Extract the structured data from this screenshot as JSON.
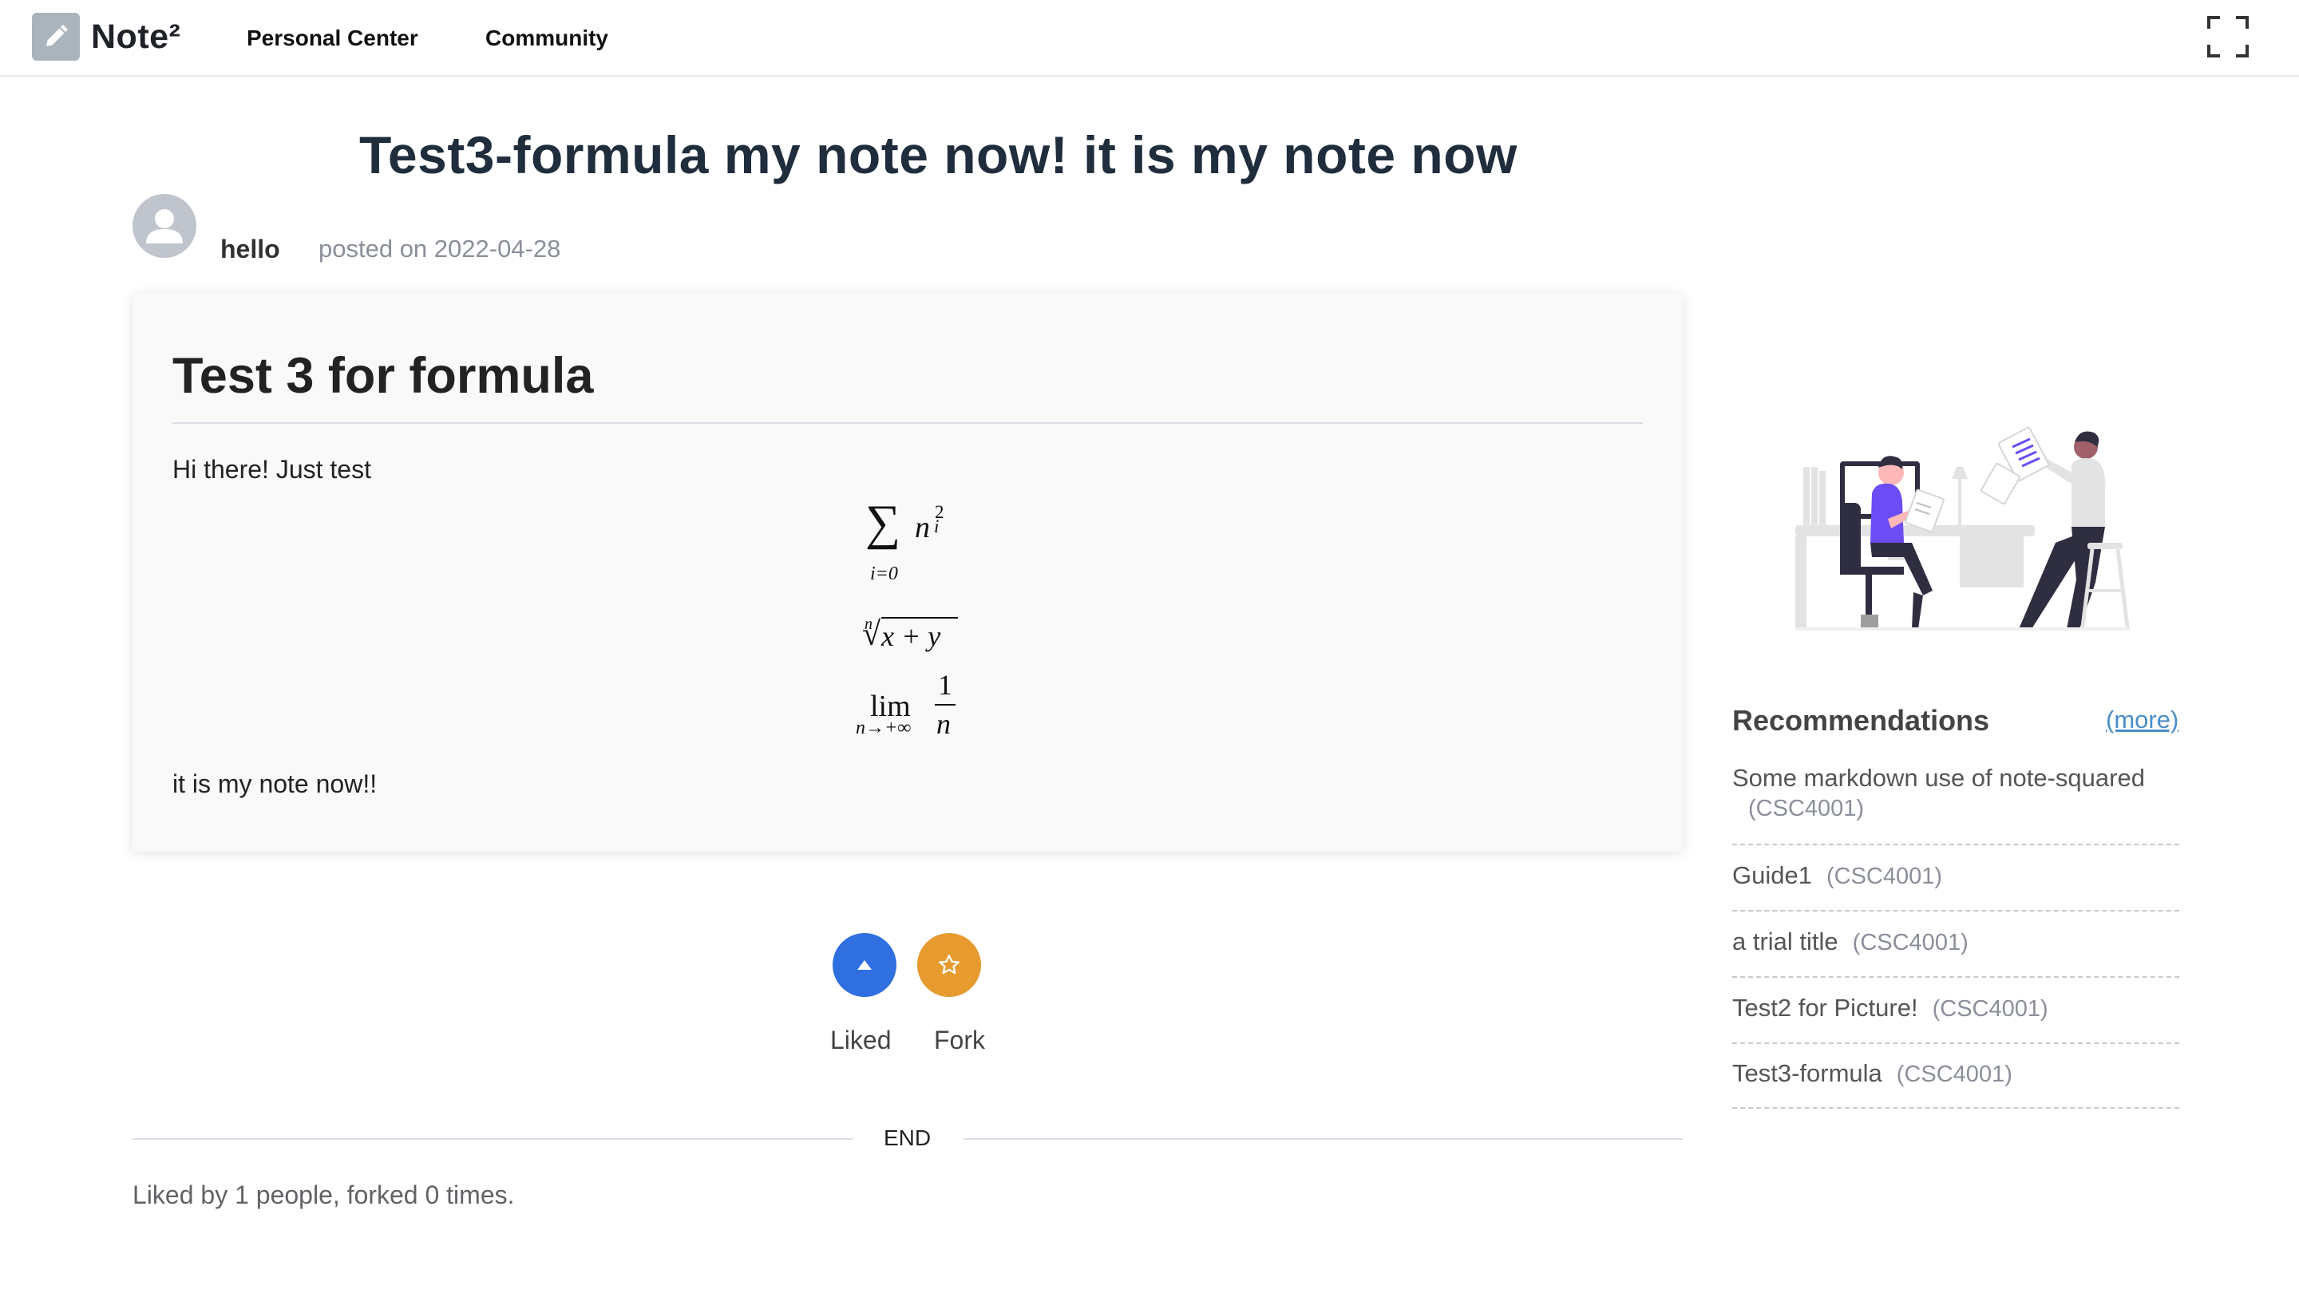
{
  "nav": {
    "logo_text": "Note²",
    "links": [
      "Personal Center",
      "Community"
    ],
    "fullscreen_icon": "fullscreen-icon"
  },
  "note": {
    "title": "Test3-formula my note now! it is my note now",
    "author": "hello",
    "posted": "posted on 2022-04-28",
    "heading": "Test 3 for formula",
    "intro": "Hi there! Just test",
    "outro": "it is my note now!!",
    "formulas": {
      "sum_symbol": "∑",
      "sum_term": "n",
      "sum_sup": "2",
      "sum_sub": "i",
      "sum_lower": "i=0",
      "root_index": "n",
      "root_symbol": "√",
      "root_body": "x + y",
      "lim_word": "lim",
      "lim_under": "n→+∞",
      "frac_num": "1",
      "frac_den": "n"
    }
  },
  "actions": {
    "liked_label": "Liked",
    "fork_label": "Fork",
    "end_text": "END",
    "stats": "Liked by 1 people, forked 0 times."
  },
  "recommendations": {
    "title": "Recommendations",
    "more": "(more)",
    "items": [
      {
        "title": "Some markdown use of note-squared",
        "course": "(CSC4001)"
      },
      {
        "title": "Guide1",
        "course": "(CSC4001)"
      },
      {
        "title": "a trial title",
        "course": "(CSC4001)"
      },
      {
        "title": "Test2 for Picture!",
        "course": "(CSC4001)"
      },
      {
        "title": "Test3-formula",
        "course": "(CSC4001)"
      }
    ]
  },
  "colors": {
    "like": "#2f6fe0",
    "fork": "#e79a2e",
    "accent_purple": "#6c4cf5"
  }
}
